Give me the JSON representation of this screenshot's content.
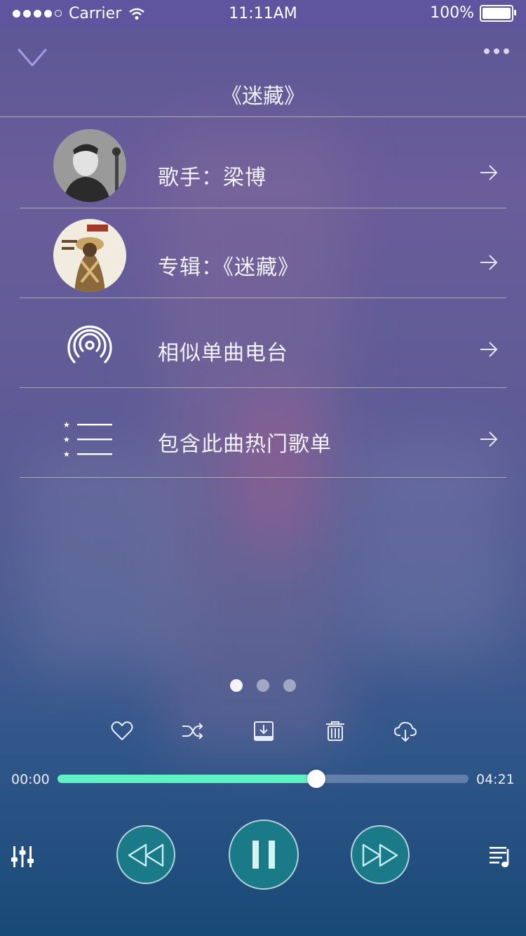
{
  "status_bar": {
    "carrier": "Carrier",
    "time": "11:11AM",
    "battery": "100%"
  },
  "header": {
    "title": "《迷藏》",
    "collapse_icon": "chevron-down-icon",
    "more_icon": "more-dots-icon"
  },
  "rows": [
    {
      "label": "歌手：梁博",
      "icon": "artist-avatar"
    },
    {
      "label": "专辑：《迷藏》",
      "icon": "album-cover"
    },
    {
      "label": "相似单曲电台",
      "icon": "radio-waves-icon"
    },
    {
      "label": "包含此曲热门歌单",
      "icon": "starred-list-icon"
    }
  ],
  "pager": {
    "count": 3,
    "active": 0
  },
  "actions": [
    "heart-icon",
    "shuffle-icon",
    "download-icon",
    "delete-icon",
    "cloud-download-icon"
  ],
  "player": {
    "elapsed": "00:00",
    "duration": "04:21",
    "progress": 0.63,
    "buttons": [
      "equalizer-icon",
      "rewind-icon",
      "pause-icon",
      "fast-forward-icon",
      "playlist-icon"
    ]
  },
  "colors": {
    "accent": "#5ff2c3",
    "button_fill": "#1a7a88"
  }
}
